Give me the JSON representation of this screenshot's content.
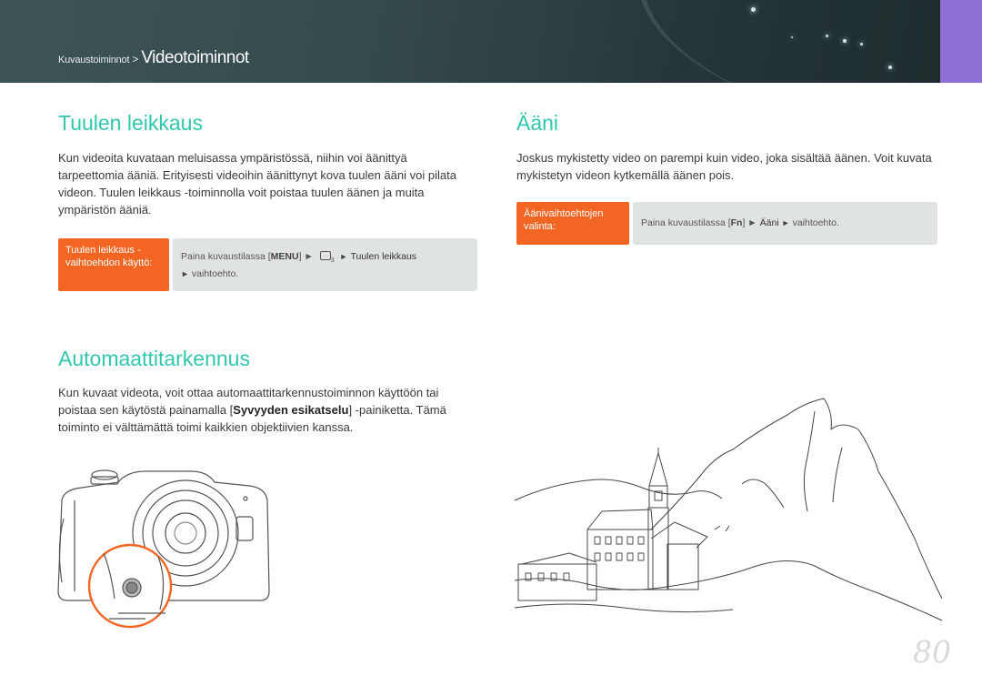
{
  "header": {
    "breadcrumb_parent": "Kuvaustoiminnot",
    "breadcrumb_separator": ">",
    "breadcrumb_current": "Videotoiminnot",
    "accent_color": "#8e6fd4"
  },
  "wind": {
    "title": "Tuulen leikkaus",
    "body": "Kun videoita kuvataan meluisassa ympäristössä, niihin voi äänittyä tarpeettomia ääniä. Erityisesti videoihin äänittynyt kova tuulen ääni voi pilata videon. Tuulen leikkaus -toiminnolla voit poistaa tuulen äänen ja muita ympäristön ääniä.",
    "label": "Tuulen leikkaus -vaihtoehdon käyttö:",
    "instr_prefix": "Paina kuvaustilassa [",
    "instr_key": "MENU",
    "instr_mid": "] ►",
    "instr_menu_icon": "video-menu-icon",
    "instr_menu_index": "3",
    "instr_arrow": "►",
    "instr_item": "Tuulen leikkaus",
    "instr_suffix_arrow": "►",
    "instr_suffix": "vaihtoehto."
  },
  "sound": {
    "title": "Ääni",
    "body": "Joskus mykistetty video on parempi kuin video, joka sisältää äänen. Voit kuvata mykistetyn videon kytkemällä äänen pois.",
    "label": "Äänivaihtoehtojen valinta:",
    "instr_prefix": "Paina kuvaustilassa [",
    "instr_key": "Fn",
    "instr_mid": "] ►",
    "instr_item": "Ääni",
    "instr_arrow": "►",
    "instr_suffix": "vaihtoehto."
  },
  "af": {
    "title": "Automaattitarkennus",
    "body_part1": "Kun kuvaat videota, voit ottaa automaattitarkennustoiminnon käyttöön tai poistaa sen käytöstä painamalla [",
    "body_bold": "Syvyyden esikatselu",
    "body_part2": "] -painiketta. Tämä toiminto ei välttämättä toimi kaikkien objektiivien kanssa."
  },
  "colors": {
    "heading": "#31c7ad",
    "label_bg": "#f26522",
    "info_bg": "#dfe3e4",
    "highlight_ring": "#f26522"
  },
  "page_number": "80"
}
